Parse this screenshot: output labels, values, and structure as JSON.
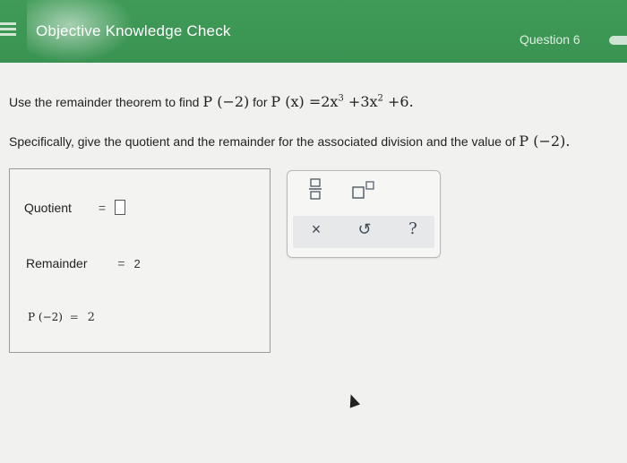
{
  "header": {
    "title": "Objective Knowledge Check",
    "question": "Question 6"
  },
  "problem": {
    "text_prefix": "Use the remainder theorem to find",
    "p_at": "P (−2)",
    "for_word": "for",
    "poly_lhs": "P (x) =2x",
    "exp3": "3",
    "term2": " +3x",
    "exp2": "2",
    "term3": " +6."
  },
  "spec": {
    "text": "Specifically, give the quotient and the remainder for the associated division and the value of",
    "p_at": "P (−2)."
  },
  "answers": {
    "quotient_label": "Quotient",
    "quotient_eq": "=",
    "remainder_label": "Remainder",
    "remainder_eq": "=",
    "remainder_value": "2",
    "p_label": "P (−2)",
    "p_eq": "=",
    "p_value": "2"
  },
  "palette": {
    "fraction_icon": "fraction-icon",
    "exponent_icon": "exponent-icon",
    "clear_label": "×",
    "undo_label": "↺",
    "help_label": "?"
  },
  "colors": {
    "header_green": "#3f9b57",
    "background": "#f1f1ef"
  }
}
